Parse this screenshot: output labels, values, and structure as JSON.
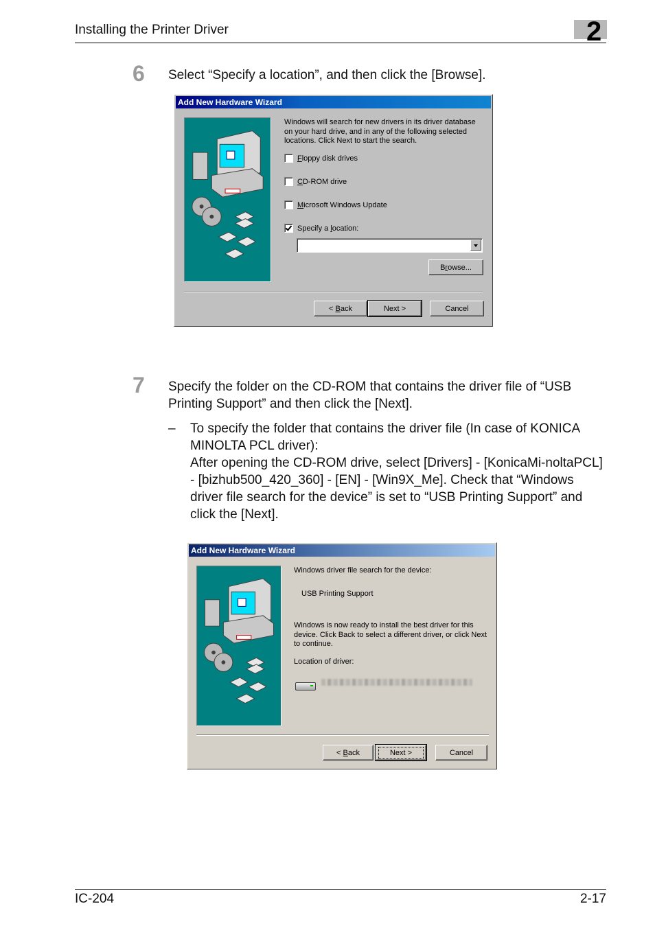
{
  "header": {
    "title": "Installing the Printer Driver",
    "chapter": "2"
  },
  "steps": [
    {
      "number": "6",
      "text": "Select “Specify a location”, and then click the [Browse]."
    },
    {
      "number": "7",
      "text": "Specify the folder on the CD-ROM that contains the driver file of “USB Printing Support” and then click the [Next].",
      "bullet_dash": "–",
      "bullet": "To specify the folder that contains the driver file (In case of KONICA MINOLTA PCL driver):\nAfter opening the CD-ROM drive, select [Drivers] - [KonicaMi-noltaPCL] - [bizhub500_420_360] - [EN] - [Win9X_Me]. Check that “Windows driver file search for the device” is set to “USB Printing Support” and click the [Next]."
    }
  ],
  "dialog1": {
    "title": "Add New Hardware Wizard",
    "intro": "Windows will search for new drivers in its driver database on your hard drive, and in any of the following selected locations. Click Next to start the search.",
    "options": [
      {
        "label_u": "F",
        "label_rest": "loppy disk drives",
        "checked": false
      },
      {
        "label_u": "C",
        "label_rest": "D-ROM drive",
        "checked": false
      },
      {
        "label_u": "M",
        "label_rest": "icrosoft Windows Update",
        "checked": false
      },
      {
        "label_pre": "Specify a ",
        "label_u": "l",
        "label_rest": "ocation:",
        "checked": true
      }
    ],
    "location_value": "",
    "browse_pre": "B",
    "browse_u": "r",
    "browse_rest": "owse...",
    "back_pre": "< ",
    "back_u": "B",
    "back_rest": "ack",
    "next": "Next >",
    "cancel": "Cancel"
  },
  "dialog2": {
    "title": "Add New Hardware Wizard",
    "search_label": "Windows driver file search for the device:",
    "device": "USB Printing Support",
    "ready_text": "Windows is now ready to install the best driver for this device. Click Back to select a different driver, or click Next to continue.",
    "location_label": "Location of driver:",
    "back_pre": "< ",
    "back_u": "B",
    "back_rest": "ack",
    "next": "Next >",
    "cancel": "Cancel"
  },
  "footer": {
    "left": "IC-204",
    "right": "2-17"
  }
}
